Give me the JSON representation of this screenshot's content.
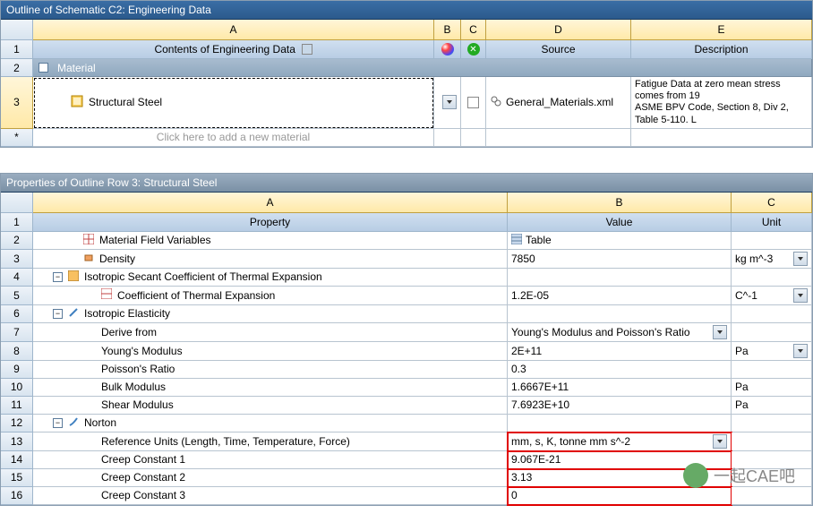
{
  "outline": {
    "title": "Outline of Schematic C2: Engineering Data",
    "cols": {
      "A": "A",
      "B": "B",
      "C": "C",
      "D": "D",
      "E": "E"
    },
    "subhead": {
      "A": "Contents of Engineering Data",
      "D": "Source",
      "E": "Description"
    },
    "rownums": {
      "r1": "1",
      "r2": "2",
      "r3": "3",
      "rstar": "*"
    },
    "group": "Material",
    "item": {
      "name": "Structural Steel",
      "source": "General_Materials.xml",
      "desc": "Fatigue Data at zero mean stress comes from 19\nASME BPV Code, Section 8, Div 2, Table 5-110. L"
    },
    "placeholder": "Click here to add a new material"
  },
  "props": {
    "title": "Properties of Outline Row 3: Structural Steel",
    "cols": {
      "A": "A",
      "B": "B",
      "C": "C"
    },
    "subhead": {
      "A": "Property",
      "B": "Value",
      "C": "Unit"
    },
    "rows": {
      "1": {
        "num": "1"
      },
      "2": {
        "num": "2",
        "prop": "Material Field Variables",
        "val": "Table"
      },
      "3": {
        "num": "3",
        "prop": "Density",
        "val": "7850",
        "unit": "kg m^-3"
      },
      "4": {
        "num": "4",
        "prop": "Isotropic Secant Coefficient of Thermal Expansion"
      },
      "5": {
        "num": "5",
        "prop": "Coefficient of Thermal Expansion",
        "val": "1.2E-05",
        "unit": "C^-1"
      },
      "6": {
        "num": "6",
        "prop": "Isotropic Elasticity"
      },
      "7": {
        "num": "7",
        "prop": "Derive from",
        "val": "Young's Modulus and Poisson's Ratio"
      },
      "8": {
        "num": "8",
        "prop": "Young's Modulus",
        "val": "2E+11",
        "unit": "Pa"
      },
      "9": {
        "num": "9",
        "prop": "Poisson's Ratio",
        "val": "0.3"
      },
      "10": {
        "num": "10",
        "prop": "Bulk Modulus",
        "val": "1.6667E+11",
        "unit": "Pa"
      },
      "11": {
        "num": "11",
        "prop": "Shear Modulus",
        "val": "7.6923E+10",
        "unit": "Pa"
      },
      "12": {
        "num": "12",
        "prop": "Norton"
      },
      "13": {
        "num": "13",
        "prop": "Reference Units (Length, Time, Temperature, Force)",
        "val": "mm, s, K, tonne mm s^-2"
      },
      "14": {
        "num": "14",
        "prop": "Creep Constant 1",
        "val": "9.067E-21"
      },
      "15": {
        "num": "15",
        "prop": "Creep Constant 2",
        "val": "3.13"
      },
      "16": {
        "num": "16",
        "prop": "Creep Constant 3",
        "val": "0"
      }
    }
  },
  "watermark": "一起CAE吧"
}
